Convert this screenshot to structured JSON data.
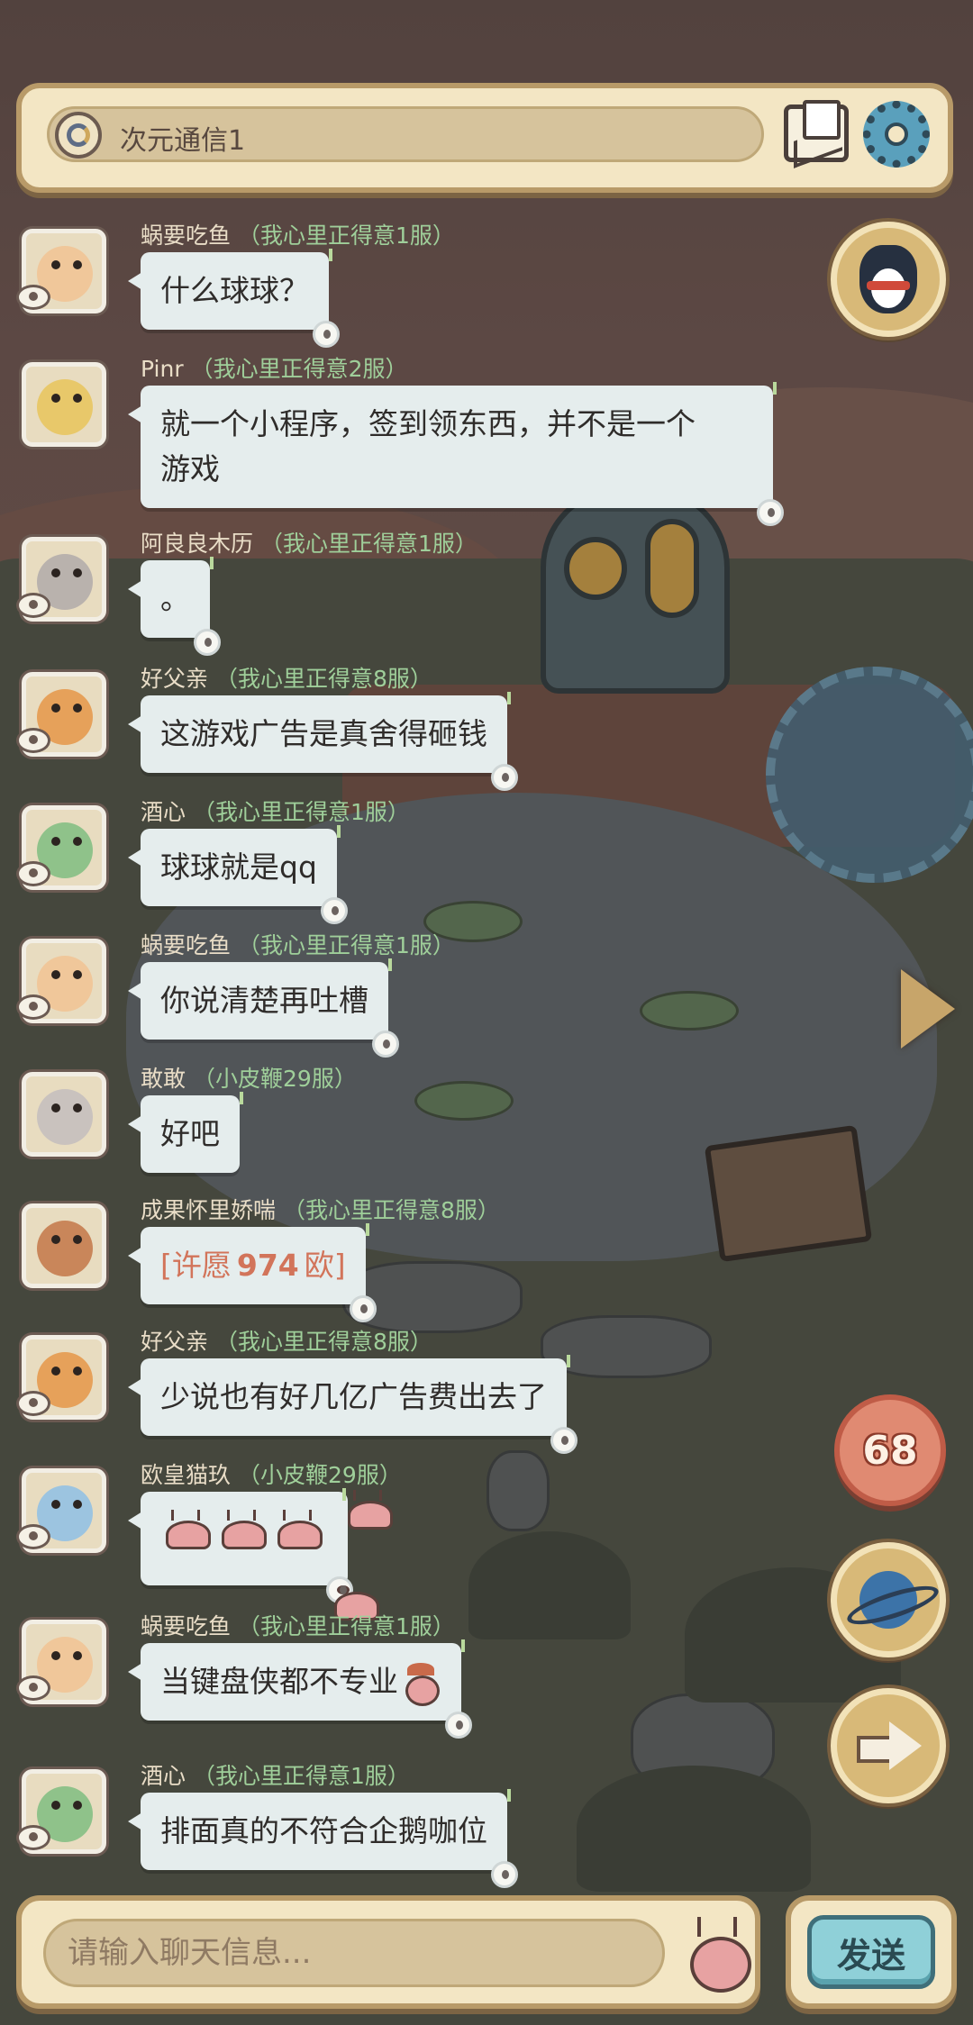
{
  "header": {
    "channel_name": "次元通信1",
    "icons": [
      "channel-icon",
      "mail-icon",
      "settings-gear-icon"
    ]
  },
  "messages": [
    {
      "sender": "蜗要吃鱼",
      "server": "（我心里正得意1服）",
      "text": "什么球球？"
    },
    {
      "sender": "Pinr",
      "server": "（我心里正得意2服）",
      "text_line1": "就一个小程序，签到领东西，并不是一个",
      "text_line2": "游戏"
    },
    {
      "sender": "阿良良木历",
      "server": "（我心里正得意1服）",
      "text": "。"
    },
    {
      "sender": "好父亲",
      "server": "（我心里正得意8服）",
      "text": "这游戏广告是真舍得砸钱"
    },
    {
      "sender": "酒心",
      "server": "（我心里正得意1服）",
      "text": "球球就是qq"
    },
    {
      "sender": "蜗要吃鱼",
      "server": "（我心里正得意1服）",
      "text": "你说清楚再吐槽"
    },
    {
      "sender": "敢敢",
      "server": "（小皮鞭29服）",
      "text": "好吧"
    },
    {
      "sender": "成果怀里娇喘",
      "server": "（我心里正得意8服）",
      "wish_prefix": "[许愿",
      "wish_value": "974",
      "wish_suffix": "欧]"
    },
    {
      "sender": "好父亲",
      "server": "（我心里正得意8服）",
      "text": "少说也有好几亿广告费出去了"
    },
    {
      "sender": "欧皇猫玖",
      "server": "（小皮鞭29服）",
      "stickers": "snail-sticker x3"
    },
    {
      "sender": "蜗要吃鱼",
      "server": "（我心里正得意1服）",
      "text": "当键盘侠都不专业"
    },
    {
      "sender": "酒心",
      "server": "（我心里正得意1服）",
      "text": "排面真的不符合企鹅咖位"
    }
  ],
  "side": {
    "notification_count": "68",
    "buttons": [
      "penguin-icon",
      "planet-icon",
      "arrow-right-icon"
    ]
  },
  "input": {
    "placeholder": "请输入聊天信息...",
    "send_label": "发送"
  }
}
